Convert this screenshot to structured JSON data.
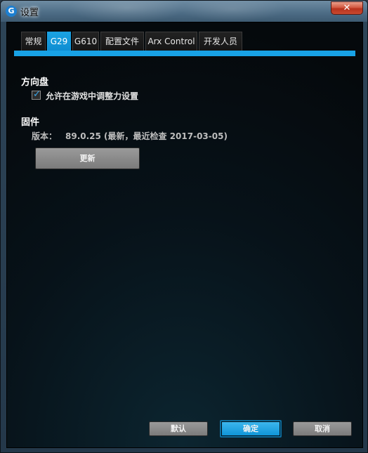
{
  "window": {
    "title": "设置",
    "app_icon_glyph": "G",
    "close_glyph": "✕"
  },
  "tabs": [
    {
      "label": "常规",
      "active": false
    },
    {
      "label": "G29",
      "active": true
    },
    {
      "label": "G610",
      "active": false
    },
    {
      "label": "配置文件",
      "active": false
    },
    {
      "label": "Arx Control",
      "active": false
    },
    {
      "label": "开发人员",
      "active": false
    }
  ],
  "steering": {
    "title": "方向盘",
    "checkbox_label": "允许在游戏中调整力设置",
    "checked": true,
    "check_glyph": "✓"
  },
  "firmware": {
    "title": "固件",
    "version_label": "版本：",
    "version_value": "89.0.25 (最新，最近检查 2017-03-05)",
    "update_label": "更新"
  },
  "footer": {
    "default_label": "默认",
    "ok_label": "确定",
    "cancel_label": "取消"
  },
  "colors": {
    "accent": "#18a2e6",
    "close": "#c94a30"
  }
}
